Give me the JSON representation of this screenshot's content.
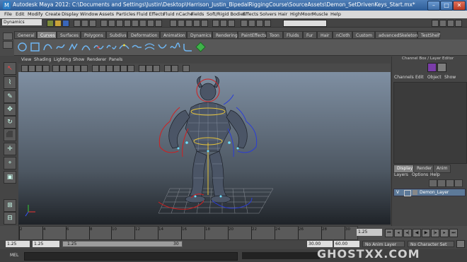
{
  "window": {
    "title": "Autodesk Maya 2012: C:\\Documents and Settings\\Justin\\Desktop\\Harrison_Justin_BipedalRiggingCourse\\SourceAssets\\Demon_SetDrivenKeys_Start.mx*",
    "app_icon": "maya-icon"
  },
  "menubar": [
    "File",
    "Edit",
    "Modify",
    "Create",
    "Display",
    "Window",
    "Assets",
    "Particles",
    "Fluid Effects",
    "Fluid nCache",
    "Fields",
    "Soft/Rigid Bodies",
    "Effects",
    "Solvers",
    "Hair",
    "HighMoon",
    "Muscle",
    "Help"
  ],
  "statusline": {
    "menu_set": "Dynamics"
  },
  "shelf_tabs": [
    "General",
    "Curves",
    "Surfaces",
    "Polygons",
    "Subdivs",
    "Deformation",
    "Animation",
    "Dynamics",
    "Rendering",
    "PaintEffects",
    "Toon",
    "Fluids",
    "Fur",
    "Hair",
    "nCloth",
    "Custom",
    "advancedSkeleton",
    "TestShelf"
  ],
  "shelf_active": "Curves",
  "panel_menu": [
    "View",
    "Shading",
    "Lighting",
    "Show",
    "Renderer",
    "Panels"
  ],
  "channel_box": {
    "title": "Channel Box / Layer Editor",
    "menus": [
      "Channels",
      "Edit",
      "Object",
      "Show"
    ]
  },
  "layer_editor": {
    "tabs": [
      "Display",
      "Render",
      "Anim"
    ],
    "menus": [
      "Layers",
      "Options",
      "Help"
    ],
    "layers": [
      {
        "visible": "V",
        "name": "Demon_Layer"
      }
    ]
  },
  "time_slider": {
    "ticks": [
      "2",
      "4",
      "6",
      "8",
      "10",
      "12",
      "14",
      "16",
      "18",
      "20",
      "22",
      "24",
      "26",
      "28",
      "30"
    ],
    "current_frame": "1.25"
  },
  "range_slider": {
    "start": "1.25",
    "playback_start": "1.25",
    "range_start_label": "1.25",
    "range_end_label": "30",
    "playback_end": "30.00",
    "end": "60.00",
    "anim_layer": "No Anim Layer",
    "character_set": "No Character Set"
  },
  "command_line": {
    "label": "MEL"
  },
  "watermark": "GHOSTXX.COM",
  "colors": {
    "title_bar": "#3a6aa6",
    "viewport_top": "#7f8fa2",
    "layer_selected": "#5d7a99",
    "curve_red": "#d21e1e",
    "curve_blue": "#2a3cd6"
  }
}
